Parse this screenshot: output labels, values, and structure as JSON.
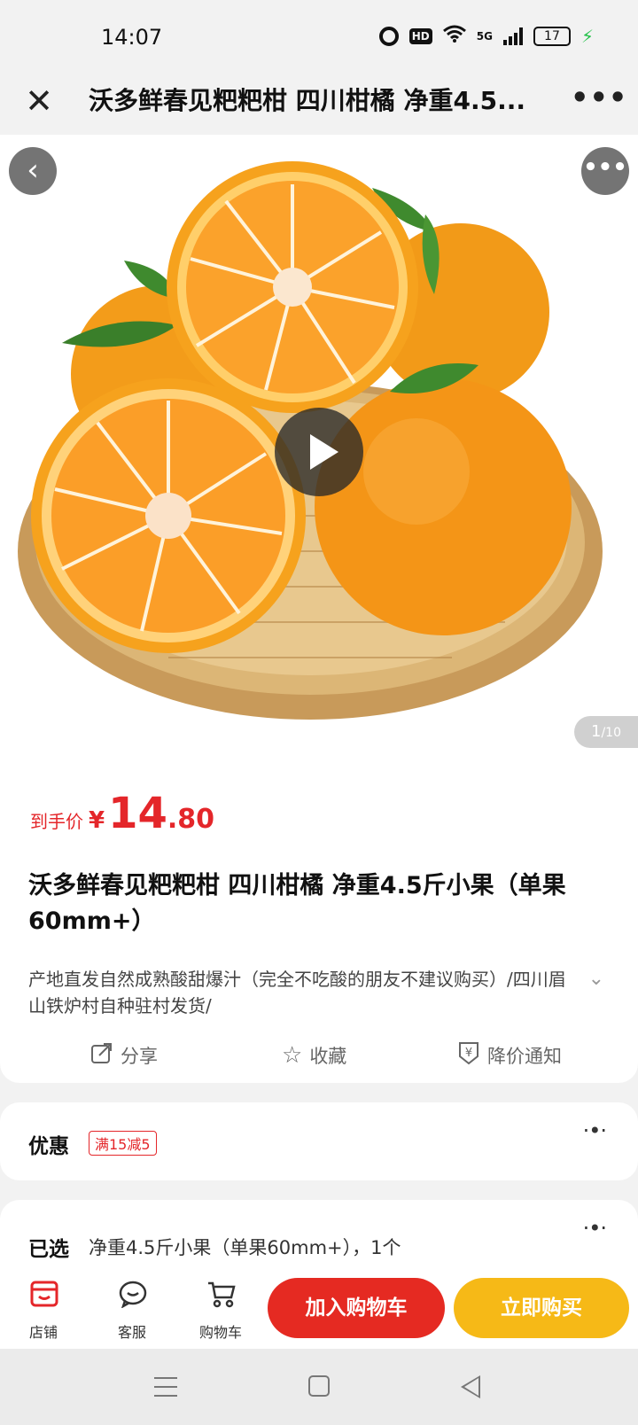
{
  "status_bar": {
    "time": "14:07",
    "hd_label": "HD",
    "network_label": "5G",
    "battery": "17",
    "icons": [
      "alarm-icon",
      "hd-icon",
      "wifi-icon",
      "signal-icon",
      "battery-icon",
      "charging-icon"
    ]
  },
  "nav": {
    "close_icon": "close-icon",
    "title": "沃多鲜春见粑粑柑 四川柑橘 净重4.5...",
    "more_icon": "more-icon"
  },
  "gallery": {
    "back_icon": "chevron-left-icon",
    "more_icon": "more-icon",
    "play_icon": "play-icon",
    "current_page": "1",
    "total_pages": "10",
    "image_subject": "oranges in bamboo basket"
  },
  "price": {
    "label": "到手价",
    "currency": "¥",
    "integer": "14",
    "decimal": ".80",
    "color": "#e4262a"
  },
  "product": {
    "title": "沃多鲜春见粑粑柑 四川柑橘 净重4.5斤小果（单果60mm+）",
    "description": "产地直发自然成熟酸甜爆汁（完全不吃酸的朋友不建议购买）/四川眉山铁炉村自种驻村发货/"
  },
  "actions": [
    {
      "label": "分享",
      "icon": "share-icon"
    },
    {
      "label": "收藏",
      "icon": "star-icon"
    },
    {
      "label": "降价通知",
      "icon": "price-drop-icon"
    }
  ],
  "promo": {
    "label": "优惠",
    "badge": "满15减5"
  },
  "selected": {
    "label": "已选",
    "value": "净重4.5斤小果（单果60mm+），1个"
  },
  "bottom_bar": {
    "tabs": [
      {
        "label": "店铺",
        "icon": "store-icon"
      },
      {
        "label": "客服",
        "icon": "customer-service-icon"
      },
      {
        "label": "购物车",
        "icon": "cart-icon"
      }
    ],
    "add_to_cart": "加入购物车",
    "buy_now": "立即购买",
    "cart_color": "#e52a22",
    "buy_color": "#f6b917"
  },
  "system_nav": {
    "icons": [
      "menu-icon",
      "home-icon",
      "back-icon"
    ]
  }
}
